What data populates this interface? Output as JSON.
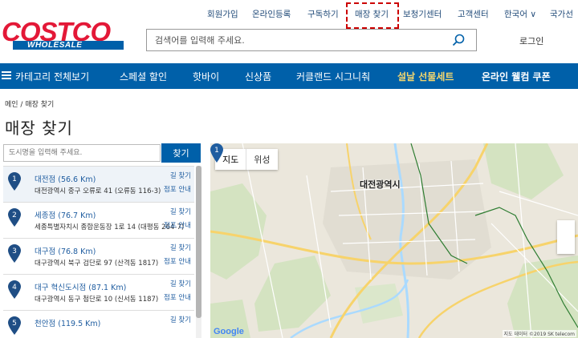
{
  "util_nav": {
    "items": [
      "회원가입",
      "온라인등록",
      "구독하기",
      "매장 찾기",
      "보청기센터",
      "고객센터",
      "한국어 ∨",
      "국가선"
    ]
  },
  "logo": {
    "main": "COSTCO",
    "sub": "WHOLESALE"
  },
  "search": {
    "placeholder": "검색어를 입력해 주세요."
  },
  "header": {
    "login": "로그인"
  },
  "main_nav": {
    "items": [
      "카테고리 전체보기",
      "스페셜 할인",
      "핫바이",
      "신상품",
      "커클랜드 시그니춰",
      "설날 선물세트",
      "온라인 웰컴 쿠폰"
    ]
  },
  "breadcrumb": "메인 / 매장 찾기",
  "page_title": "매장 찾기",
  "store_search": {
    "placeholder": "도시명을 입력해 주세요.",
    "button": "찾기"
  },
  "stores": [
    {
      "num": "1",
      "name": "대전점 (56.6 Km)",
      "address": "대전광역시 중구 오류로 41 (오류동 116-3)",
      "directions": "길 찾기",
      "info": "점포 안내"
    },
    {
      "num": "2",
      "name": "세종점 (76.7 Km)",
      "address": "세종특별자치시 종합운동장 1로 14 (대평동 264-7)",
      "directions": "길 찾기",
      "info": "점포 안내"
    },
    {
      "num": "3",
      "name": "대구점 (76.8 Km)",
      "address": "대구광역시 북구 검단로 97 (산격동 1817)",
      "directions": "길 찾기",
      "info": "점포 안내"
    },
    {
      "num": "4",
      "name": "대구 혁신도시점 (87.1 Km)",
      "address": "대구광역시 동구 첨단로 10 (신서동 1187)",
      "directions": "길 찾기",
      "info": "점포 안내"
    },
    {
      "num": "5",
      "name": "천안점 (119.5 Km)",
      "address": "",
      "directions": "길 찾기",
      "info": ""
    }
  ],
  "map": {
    "toggle": [
      "지도",
      "위성"
    ],
    "city_label": "대전광역시",
    "marker": "1",
    "google": "Google",
    "credit": "지도 데이터 ©2019 SK telecom"
  },
  "colors": {
    "brand_blue": "#0060a9",
    "brand_red": "#e31837",
    "link": "#1f5da0",
    "highlight": "#cc0000"
  }
}
